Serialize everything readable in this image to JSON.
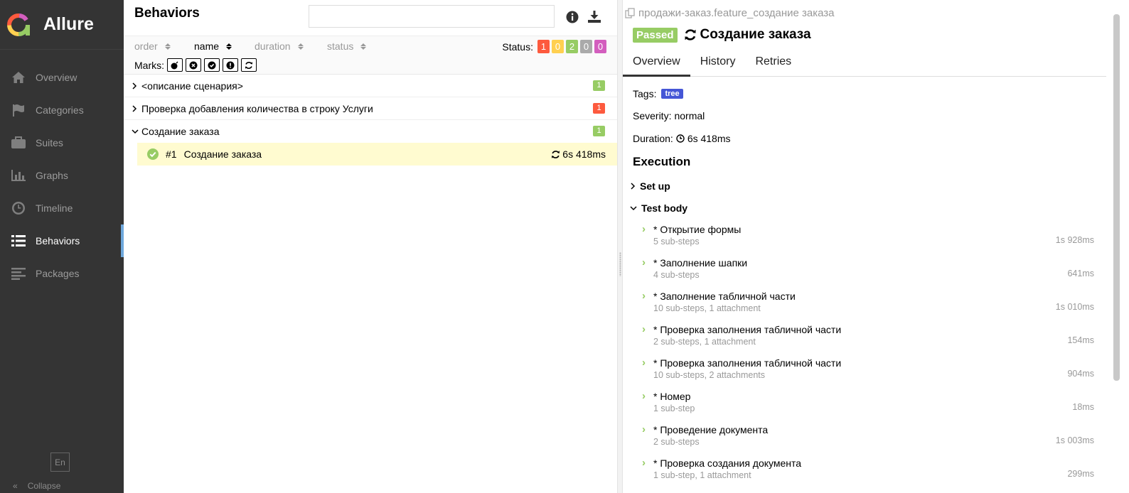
{
  "app": {
    "name": "Allure"
  },
  "sidebar": {
    "items": [
      {
        "label": "Overview",
        "icon": "home-icon"
      },
      {
        "label": "Categories",
        "icon": "flag-icon"
      },
      {
        "label": "Suites",
        "icon": "briefcase-icon"
      },
      {
        "label": "Graphs",
        "icon": "bar-chart-icon"
      },
      {
        "label": "Timeline",
        "icon": "clock-icon"
      },
      {
        "label": "Behaviors",
        "icon": "list-icon",
        "active": true
      },
      {
        "label": "Packages",
        "icon": "align-left-icon"
      }
    ],
    "language": "En",
    "collapse_label": "Collapse"
  },
  "behaviors": {
    "title": "Behaviors",
    "search_placeholder": "",
    "sort": {
      "order": "order",
      "name": "name",
      "duration": "duration",
      "status": "status"
    },
    "status_label": "Status:",
    "status_counts": [
      {
        "value": "1",
        "color": "#fd5a3e"
      },
      {
        "value": "0",
        "color": "#ffd050"
      },
      {
        "value": "2",
        "color": "#97cc64"
      },
      {
        "value": "0",
        "color": "#aaaaaa"
      },
      {
        "value": "0",
        "color": "#d35ebe"
      }
    ],
    "marks_label": "Marks:",
    "groups": [
      {
        "name": "<описание сценария>",
        "count": "1",
        "count_color": "#97cc64",
        "expanded": false
      },
      {
        "name": "Проверка добавления количества в строку Услуги",
        "count": "1",
        "count_color": "#fd5a3e",
        "expanded": false
      },
      {
        "name": "Создание заказа",
        "count": "1",
        "count_color": "#97cc64",
        "expanded": true
      }
    ],
    "selected_test": {
      "num": "#1",
      "name": "Создание заказа",
      "duration": "6s 418ms"
    }
  },
  "details": {
    "breadcrumb": "продажи-заказ.feature_создание заказа",
    "status": "Passed",
    "title": "Создание заказа",
    "tabs": [
      "Overview",
      "History",
      "Retries"
    ],
    "tags_label": "Tags:",
    "tag": "tree",
    "severity_label": "Severity:",
    "severity": "normal",
    "duration_label": "Duration:",
    "duration": "6s 418ms",
    "execution_title": "Execution",
    "setup_label": "Set up",
    "body_label": "Test body",
    "steps": [
      {
        "name": "* Открытие формы",
        "sub": "5 sub-steps",
        "dur": "1s 928ms"
      },
      {
        "name": "* Заполнение шапки",
        "sub": "4 sub-steps",
        "dur": "641ms"
      },
      {
        "name": "* Заполнение табличной части",
        "sub": "10 sub-steps, 1 attachment",
        "dur": "1s 010ms"
      },
      {
        "name": "* Проверка заполнения табличной части",
        "sub": "2 sub-steps, 1 attachment",
        "dur": "154ms"
      },
      {
        "name": "* Проверка заполнения табличной части",
        "sub": "10 sub-steps, 2 attachments",
        "dur": "904ms"
      },
      {
        "name": "* Номер",
        "sub": "1 sub-step",
        "dur": "18ms"
      },
      {
        "name": "* Проведение документа",
        "sub": "2 sub-steps",
        "dur": "1s 003ms"
      },
      {
        "name": "* Проверка создания документа",
        "sub": "1 sub-step, 1 attachment",
        "dur": "299ms"
      }
    ]
  }
}
